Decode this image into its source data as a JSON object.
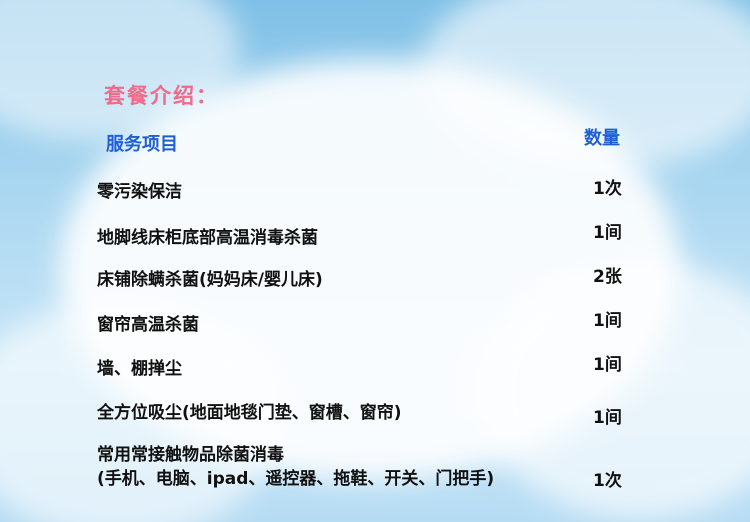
{
  "title": "套餐介绍：",
  "headers": {
    "service": "服务项目",
    "quantity": "数量"
  },
  "rows": [
    {
      "service": "零污染保洁",
      "service_line2": "",
      "quantity": "1次"
    },
    {
      "service": "地脚线床柜底部高温消毒杀菌",
      "service_line2": "",
      "quantity": "1间"
    },
    {
      "service": "床铺除螨杀菌(妈妈床/婴儿床)",
      "service_line2": "",
      "quantity": "2张"
    },
    {
      "service": "窗帘高温杀菌",
      "service_line2": "",
      "quantity": "1间"
    },
    {
      "service": "墙、棚掸尘",
      "service_line2": "",
      "quantity": "1间"
    },
    {
      "service": "全方位吸尘(地面地毯门垫、窗槽、窗帘)",
      "service_line2": "",
      "quantity": "1间"
    },
    {
      "service": "常用常接触物品除菌消毒",
      "service_line2": "(手机、电脑、ipad、遥控器、拖鞋、开关、门把手)",
      "quantity": "1次"
    }
  ],
  "colors": {
    "title": "#f06a8a",
    "header": "#1f5fd6",
    "text": "#111111",
    "sky": "#7fc0e6"
  }
}
